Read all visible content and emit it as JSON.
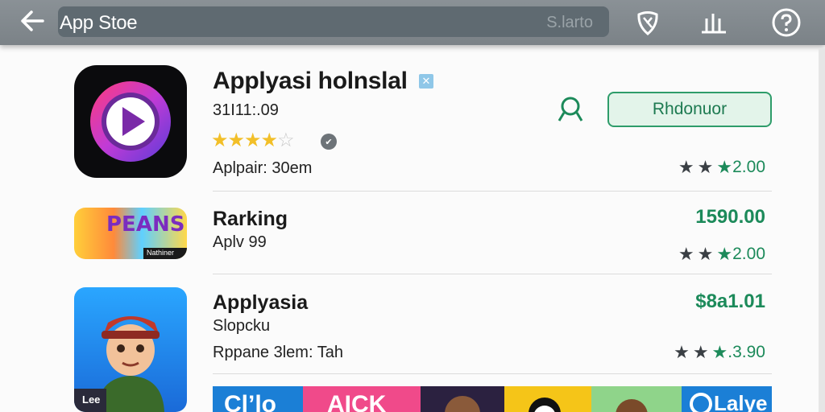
{
  "topbar": {
    "title": "App Stoe",
    "search_hint": "S.larto",
    "icons": [
      "back-arrow-icon",
      "shield-icon",
      "chart-icon",
      "help-icon"
    ]
  },
  "featured": {
    "title": "Applyasi holnslal",
    "subtitle": "31I11:.09",
    "rating": 4,
    "meta": "Aplpair: 30em",
    "install_label": "Rhdonuor",
    "rating_value": "2.00"
  },
  "items": [
    {
      "title": "Rarking",
      "subtitle": "Aplv 99",
      "price": "1590.00",
      "rating_value": "2.00",
      "icon_text": "PEANS",
      "icon_caption": "Nathiner"
    },
    {
      "title": "Applyasia",
      "subtitle": "Slopcku",
      "meta": "Rppane 3lem: Tah",
      "price": "$8a1.01",
      "rating_value": ".3.90",
      "icon_caption": "Lee"
    }
  ],
  "banner": {
    "tiles": [
      "Cl’lo",
      "AICK",
      "",
      "",
      "",
      "Lalye"
    ]
  },
  "colors": {
    "accent_green": "#1c8a5a",
    "topbar": "#7d858a",
    "star": "#f2bf28"
  }
}
